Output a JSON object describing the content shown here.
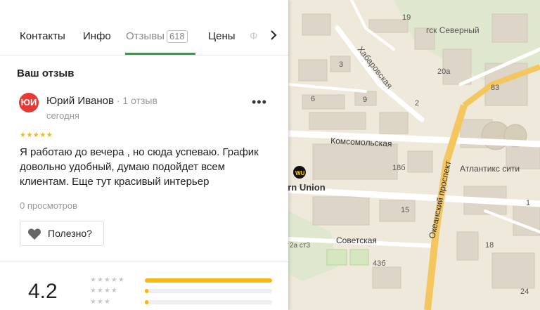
{
  "tabs": {
    "items": [
      {
        "label": "Контакты"
      },
      {
        "label": "Инфо"
      },
      {
        "label": "Отзывы",
        "badge": "618"
      },
      {
        "label": "Цены"
      },
      {
        "label": "Ф"
      }
    ]
  },
  "review": {
    "section_title": "Ваш отзыв",
    "avatar_initials": "ЮИ",
    "author_name": "Юрий Иванов",
    "author_meta": " · 1 отзыв",
    "date": "сегодня",
    "stars": "★★★★★",
    "text": "Я работаю до вечера , но сюда успеваю. График довольно удобный, думаю подойдет всем клиентам. Еще тут красивый интерьер",
    "views": "0 просмотров",
    "useful_label": "Полезно?"
  },
  "rating_summary": {
    "average": "4.2",
    "rows": [
      {
        "stars": "★★★★★",
        "share": 1.0
      },
      {
        "stars": "★★★★",
        "share": 0.03
      },
      {
        "stars": "★★★",
        "share": 0.03
      }
    ]
  },
  "map": {
    "labels": {
      "gsk": "гск Северный",
      "khabarovskaya": "Хабаровская",
      "komsomolskaya": "Комсомольская",
      "okeansky": "Океанский проспект",
      "atlantiks": "Атлантикс сити",
      "western_union": "ern Union",
      "sovetskaya": "Советская",
      "b19": "19",
      "b20a": "20а",
      "b83": "83",
      "b3": "3",
      "b9": "9",
      "b2": "2",
      "b6": "6",
      "b18b": "18б",
      "b15": "15",
      "b43b": "43б",
      "b2a": "2а ст3",
      "b18": "18",
      "b24": "24",
      "b1": "1"
    },
    "colors": {
      "land": "#efe9dc",
      "road": "#ffffff",
      "avenue": "#f4c660",
      "building": "#ddd6c8",
      "park": "#d4e7bf"
    }
  }
}
